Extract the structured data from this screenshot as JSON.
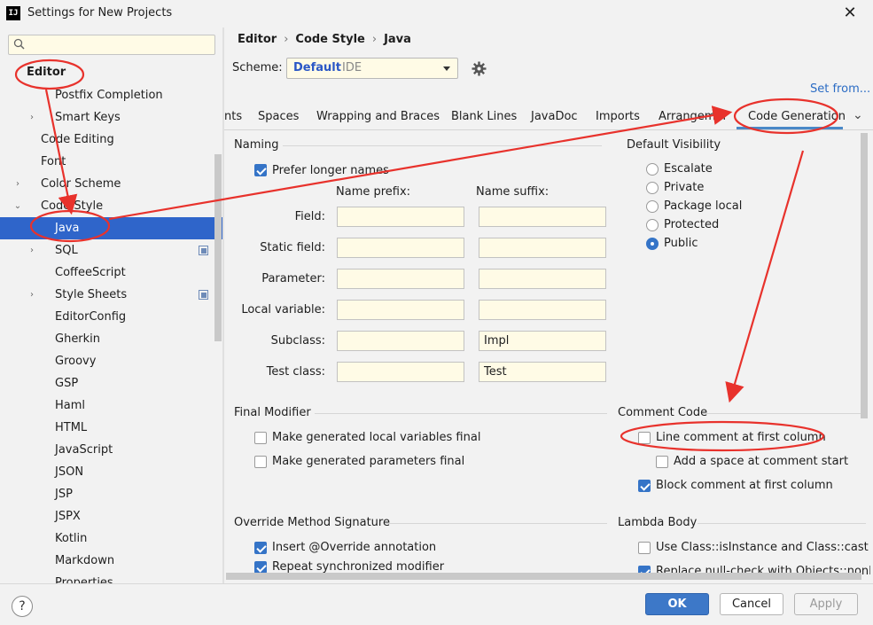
{
  "window": {
    "app_icon": "IJ",
    "title": "Settings for New Projects",
    "close_glyph": "✕"
  },
  "sidebar": {
    "search_placeholder": "",
    "items": [
      {
        "label": "Editor",
        "bold": true,
        "expanded": true
      },
      {
        "label": "Postfix Completion"
      },
      {
        "label": "Smart Keys",
        "arrow": "›"
      },
      {
        "label": "Code Editing"
      },
      {
        "label": "Font"
      },
      {
        "label": "Color Scheme",
        "arrow": "›"
      },
      {
        "label": "Code Style",
        "arrow": "⌄"
      },
      {
        "label": "Java",
        "selected": true
      },
      {
        "label": "SQL",
        "arrow": "›",
        "copy_icon": true
      },
      {
        "label": "CoffeeScript"
      },
      {
        "label": "Style Sheets",
        "arrow": "›",
        "copy_icon": true
      },
      {
        "label": "EditorConfig"
      },
      {
        "label": "Gherkin"
      },
      {
        "label": "Groovy"
      },
      {
        "label": "GSP"
      },
      {
        "label": "Haml"
      },
      {
        "label": "HTML"
      },
      {
        "label": "JavaScript"
      },
      {
        "label": "JSON"
      },
      {
        "label": "JSP"
      },
      {
        "label": "JSPX"
      },
      {
        "label": "Kotlin"
      },
      {
        "label": "Markdown"
      },
      {
        "label": "Properties"
      }
    ]
  },
  "breadcrumb": {
    "part1": "Editor",
    "sep1": "›",
    "part2": "Code Style",
    "sep2": "›",
    "part3": "Java"
  },
  "scheme": {
    "label": "Scheme:",
    "name": "Default",
    "type": "IDE"
  },
  "set_from": "Set from...",
  "tabs": [
    "nts",
    "Spaces",
    "Wrapping and Braces",
    "Blank Lines",
    "JavaDoc",
    "Imports",
    "Arrangement",
    "Code Generation"
  ],
  "tabs_more": "⌄",
  "naming": {
    "title": "Naming",
    "prefer_longer": {
      "label": "Prefer longer names",
      "checked": true
    },
    "prefix_header": "Name prefix:",
    "suffix_header": "Name suffix:",
    "rows": [
      {
        "label": "Field:",
        "prefix": "",
        "suffix": ""
      },
      {
        "label": "Static field:",
        "prefix": "",
        "suffix": ""
      },
      {
        "label": "Parameter:",
        "prefix": "",
        "suffix": ""
      },
      {
        "label": "Local variable:",
        "prefix": "",
        "suffix": ""
      },
      {
        "label": "Subclass:",
        "prefix": "",
        "suffix": "Impl"
      },
      {
        "label": "Test class:",
        "prefix": "",
        "suffix": "Test"
      }
    ]
  },
  "visibility": {
    "title": "Default Visibility",
    "options": [
      {
        "label": "Escalate",
        "checked": false
      },
      {
        "label": "Private",
        "checked": false
      },
      {
        "label": "Package local",
        "checked": false
      },
      {
        "label": "Protected",
        "checked": false
      },
      {
        "label": "Public",
        "checked": true
      }
    ]
  },
  "final_modifier": {
    "title": "Final Modifier",
    "items": [
      {
        "label": "Make generated local variables final",
        "checked": false
      },
      {
        "label": "Make generated parameters final",
        "checked": false
      }
    ]
  },
  "comment_code": {
    "title": "Comment Code",
    "items": [
      {
        "label": "Line comment at first column",
        "checked": false
      },
      {
        "label": "Add a space at comment start",
        "checked": false
      },
      {
        "label": "Block comment at first column",
        "checked": true
      }
    ]
  },
  "override": {
    "title": "Override Method Signature",
    "items": [
      {
        "label": "Insert @Override annotation",
        "checked": true
      },
      {
        "label": "Repeat synchronized modifier",
        "checked": true
      }
    ]
  },
  "lambda": {
    "title": "Lambda Body",
    "items": [
      {
        "label": "Use Class::isInstance and Class::cast when",
        "checked": false
      },
      {
        "label": "Replace null-check with Objects::nonNull o",
        "checked": true
      }
    ]
  },
  "buttons": {
    "help": "?",
    "ok": "OK",
    "cancel": "Cancel",
    "apply": "Apply"
  },
  "colors": {
    "accent": "#2f65ca",
    "annotation": "#e8322c",
    "link": "#2b6cc4"
  }
}
